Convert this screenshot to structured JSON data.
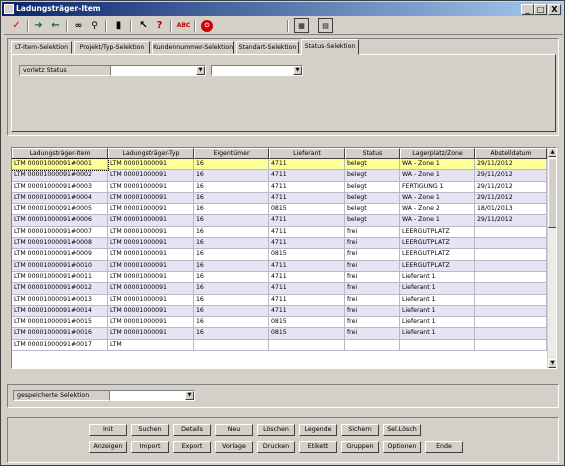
{
  "window": {
    "title": "Ladungsträger-Item",
    "controls": [
      "_",
      "□",
      "X"
    ]
  },
  "toolbar": {
    "icons": [
      "check-icon",
      "forward-arrow-icon",
      "back-arrow-icon",
      "binoculars-icon",
      "magnifier-icon",
      "trash-icon",
      "pointer-help-icon",
      "help-question-icon",
      "spellcheck-icon",
      "exit-icon",
      "calendar-icon",
      "form-icon"
    ]
  },
  "tabs": [
    "LT-Item-Selektion",
    "Projekt/Typ-Selektion",
    "Kundennummer-Selektion",
    "Standart-Selektion",
    "Status-Selektion"
  ],
  "active_tab": 4,
  "status_filter": {
    "label": "vorletz Status",
    "value1": "",
    "value2": ""
  },
  "table": {
    "columns": [
      "Ladungsträger-Item",
      "Ladungsträger-Typ",
      "Eigentümer",
      "Lieferant",
      "Status",
      "Lagerplatz/Zone",
      "Abstelldatum"
    ],
    "rows": [
      [
        "LTM 00001000091#0001",
        "LTM 00001000091",
        "16",
        "4711",
        "belegt",
        "WA - Zone 1",
        "29/11/2012"
      ],
      [
        "LTM 00001000091#0002",
        "LTM 00001000091",
        "16",
        "4711",
        "belegt",
        "WA - Zone 1",
        "29/11/2012"
      ],
      [
        "LTM 00001000091#0003",
        "LTM 00001000091",
        "16",
        "4711",
        "belegt",
        "FERTIGUNG 1",
        "29/11/2012"
      ],
      [
        "LTM 00001000091#0004",
        "LTM 00001000091",
        "16",
        "4711",
        "belegt",
        "WA - Zone 1",
        "29/11/2012"
      ],
      [
        "LTM 00001000091#0005",
        "LTM 00001000091",
        "16",
        "0815",
        "belegt",
        "WA - Zone 2",
        "18/01/2013"
      ],
      [
        "LTM 00001000091#0006",
        "LTM 00001000091",
        "16",
        "4711",
        "belegt",
        "WA - Zone 1",
        "29/11/2012"
      ],
      [
        "LTM 00001000091#0007",
        "LTM 00001000091",
        "16",
        "4711",
        "frei",
        "LEERGUTPLATZ",
        ""
      ],
      [
        "LTM 00001000091#0008",
        "LTM 00001000091",
        "16",
        "4711",
        "frei",
        "LEERGUTPLATZ",
        ""
      ],
      [
        "LTM 00001000091#0009",
        "LTM 00001000091",
        "16",
        "0815",
        "frei",
        "LEERGUTPLATZ",
        ""
      ],
      [
        "LTM 00001000091#0010",
        "LTM 00001000091",
        "16",
        "4711",
        "frei",
        "LEERGUTPLATZ",
        ""
      ],
      [
        "LTM 00001000091#0011",
        "LTM 00001000091",
        "16",
        "4711",
        "frei",
        "Lieferant 1",
        ""
      ],
      [
        "LTM 00001000091#0012",
        "LTM 00001000091",
        "16",
        "4711",
        "frei",
        "Lieferant 1",
        ""
      ],
      [
        "LTM 00001000091#0013",
        "LTM 00001000091",
        "16",
        "4711",
        "frei",
        "Lieferant 1",
        ""
      ],
      [
        "LTM 00001000091#0014",
        "LTM 00001000091",
        "16",
        "4711",
        "frei",
        "Lieferant 1",
        ""
      ],
      [
        "LTM 00001000091#0015",
        "LTM 00001000091",
        "16",
        "0815",
        "frei",
        "Lieferant 1",
        ""
      ],
      [
        "LTM 00001000091#0016",
        "LTM 00001000091",
        "16",
        "0815",
        "frei",
        "Lieferant 1",
        ""
      ],
      [
        "LTM 00001000091#0017",
        "LTM",
        "",
        "",
        "",
        "",
        ""
      ]
    ]
  },
  "saved_selection": {
    "label": "gespeicherte Selektion",
    "value": ""
  },
  "buttons_row1": [
    "Init",
    "Suchen",
    "Details",
    "Neu",
    "Löschen",
    "Legende",
    "Sichern",
    "Sel.Lösch"
  ],
  "buttons_row2": [
    "Anzeigen",
    "Import",
    "Export",
    "Vorlage",
    "Drucken",
    "Etikett",
    "Gruppen",
    "Optionen",
    "Ende"
  ],
  "colors": {
    "title_start": "#0a246a",
    "title_end": "#a6caf0",
    "row_alt": "#e4e4f4",
    "row_selected": "#ffff99"
  }
}
